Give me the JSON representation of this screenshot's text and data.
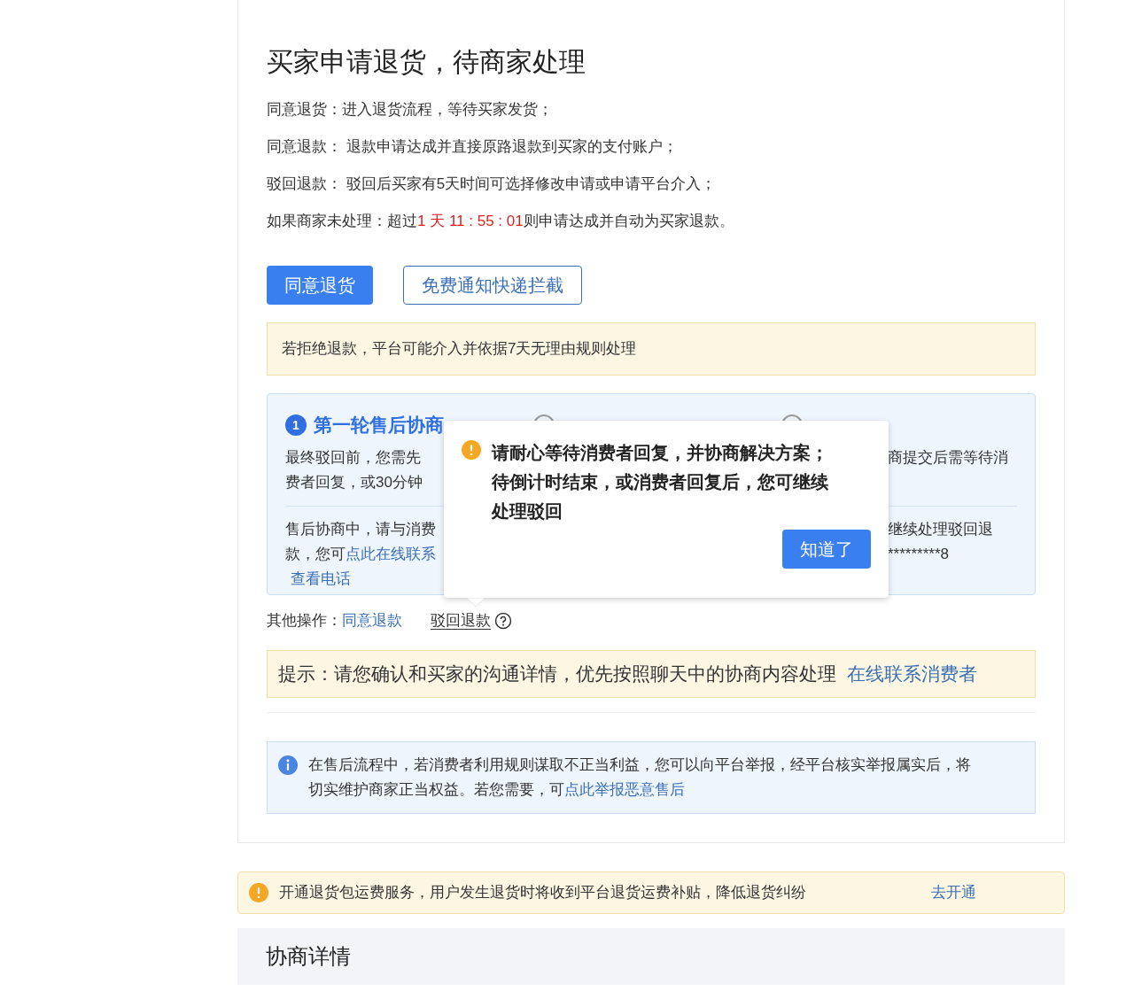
{
  "title": "买家申请退货，待商家处理",
  "rules": [
    {
      "label": "同意退货：",
      "text": "进入退货流程，等待买家发货；"
    },
    {
      "label": "同意退款：",
      "text": " 退款申请达成并直接原路退款到买家的支付账户；"
    },
    {
      "label": "驳回退款：",
      "text": " 驳回后买家有5天时间可选择修改申请或申请平台介入；"
    }
  ],
  "countdown": {
    "prefix": "如果商家未处理：超过",
    "value": "1 天 11 : 55 : 01",
    "suffix": "则申请达成并自动为买家退款。"
  },
  "buttons": [
    {
      "label": "同意退货",
      "kind": "primary"
    },
    {
      "label": "免费通知快递拦截",
      "kind": "outline"
    }
  ],
  "warning": "若拒绝退款，平台可能介入并依据7天无理由规则处理",
  "steps": [
    {
      "number": "1",
      "label": "第一轮售后协商",
      "selected": true
    },
    {
      "selected": false
    },
    {
      "selected": false
    }
  ],
  "step_notes": [
    {
      "left": [
        "最终驳回前，您需先",
        "费者回复，或30分钟"
      ],
      "right": [
        "商提交后需等待消"
      ]
    },
    {
      "left": [
        "售后协商中，请与消费",
        "款，您可"
      ],
      "left_link": "点此在线联系",
      "left_extra_link": "查看电话",
      "right": [
        "继续处理驳回退",
        "*********8"
      ]
    }
  ],
  "popover": {
    "text": "请耐心等待消费者回复，并协商解决方案；待倒计时结束，或消费者回复后，您可继续处理驳回",
    "button": "知道了"
  },
  "other_actions": {
    "label": "其他操作：",
    "links": [
      "同意退款",
      "驳回退款"
    ]
  },
  "tip": {
    "text": "提示：请您确认和买家的沟通详情，优先按照聊天中的协商内容处理",
    "link": "在线联系消费者"
  },
  "info": {
    "text": "在售后流程中，若消费者利用规则谋取不正当利益，您可以向平台举报，经平台核实举报属实后，将切实维护商家正当权益。若您需要，可",
    "link": "点此举报恶意售后"
  },
  "service_banner": {
    "text": "开通退货包运费服务，用户发生退货时将收到平台退货运费补贴，降低退货纠纷",
    "link": "去开通"
  },
  "section_title": "协商详情"
}
